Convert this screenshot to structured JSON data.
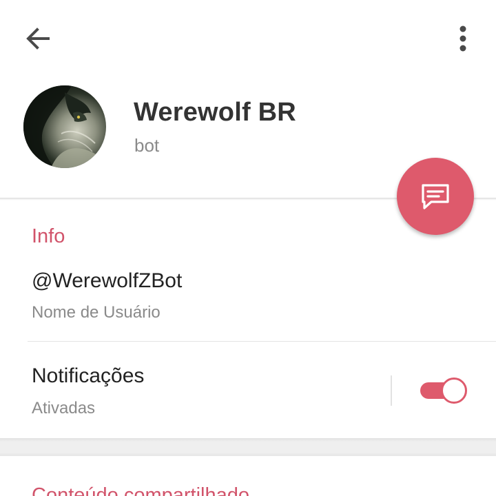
{
  "profile": {
    "name": "Werewolf BR",
    "status": "bot"
  },
  "info": {
    "title": "Info",
    "username": "@WerewolfZBot",
    "username_caption": "Nome de Usuário",
    "notifications_label": "Notificações",
    "notifications_status": "Ativadas",
    "notifications_enabled": true
  },
  "shared": {
    "title": "Conteúdo compartilhado"
  },
  "colors": {
    "accent": "#de5a6c",
    "section_title": "#d1536a",
    "primary_text": "#222222",
    "secondary_text": "#8a8a8a",
    "icon": "#4a4a4a"
  },
  "icons": {
    "back": "arrow-left-icon",
    "menu": "more-vertical-icon",
    "fab": "message-icon"
  }
}
